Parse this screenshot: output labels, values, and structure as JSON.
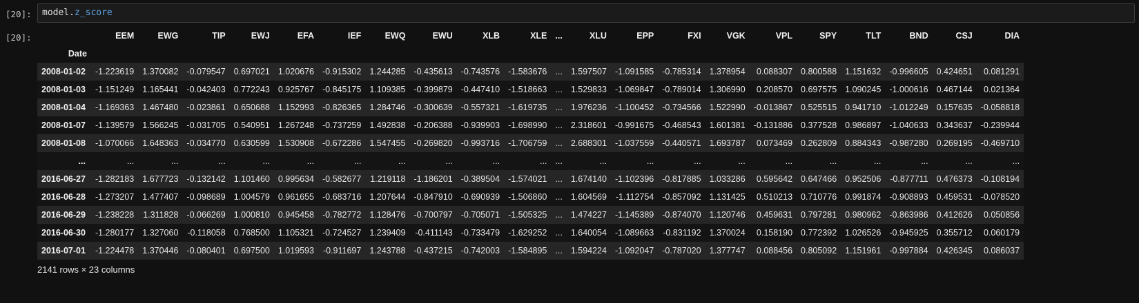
{
  "cell": {
    "in_prompt": "[20]:",
    "out_prompt": "[20]:",
    "code_object": "model.",
    "code_attr": "z_score"
  },
  "table": {
    "index_name": "Date",
    "columns": [
      "EEM",
      "EWG",
      "TIP",
      "EWJ",
      "EFA",
      "IEF",
      "EWQ",
      "EWU",
      "XLB",
      "XLE",
      "...",
      "XLU",
      "EPP",
      "FXI",
      "VGK",
      "VPL",
      "SPY",
      "TLT",
      "BND",
      "CSJ",
      "DIA"
    ],
    "rows": [
      {
        "index": "2008-01-02",
        "values": [
          "-1.223619",
          "1.370082",
          "-0.079547",
          "0.697021",
          "1.020676",
          "-0.915302",
          "1.244285",
          "-0.435613",
          "-0.743576",
          "-1.583676",
          "...",
          "1.597507",
          "-1.091585",
          "-0.785314",
          "1.378954",
          "0.088307",
          "0.800588",
          "1.151632",
          "-0.996605",
          "0.424651",
          "0.081291"
        ]
      },
      {
        "index": "2008-01-03",
        "values": [
          "-1.151249",
          "1.165441",
          "-0.042403",
          "0.772243",
          "0.925767",
          "-0.845175",
          "1.109385",
          "-0.399879",
          "-0.447410",
          "-1.518663",
          "...",
          "1.529833",
          "-1.069847",
          "-0.789014",
          "1.306990",
          "0.208570",
          "0.697575",
          "1.090245",
          "-1.000616",
          "0.467144",
          "0.021364"
        ]
      },
      {
        "index": "2008-01-04",
        "values": [
          "-1.169363",
          "1.467480",
          "-0.023861",
          "0.650688",
          "1.152993",
          "-0.826365",
          "1.284746",
          "-0.300639",
          "-0.557321",
          "-1.619735",
          "...",
          "1.976236",
          "-1.100452",
          "-0.734566",
          "1.522990",
          "-0.013867",
          "0.525515",
          "0.941710",
          "-1.012249",
          "0.157635",
          "-0.058818"
        ]
      },
      {
        "index": "2008-01-07",
        "values": [
          "-1.139579",
          "1.566245",
          "-0.031705",
          "0.540951",
          "1.267248",
          "-0.737259",
          "1.492838",
          "-0.206388",
          "-0.939903",
          "-1.698990",
          "...",
          "2.318601",
          "-0.991675",
          "-0.468543",
          "1.601381",
          "-0.131886",
          "0.377528",
          "0.986897",
          "-1.040633",
          "0.343637",
          "-0.239944"
        ]
      },
      {
        "index": "2008-01-08",
        "values": [
          "-1.070066",
          "1.648363",
          "-0.034770",
          "0.630599",
          "1.530908",
          "-0.672286",
          "1.547455",
          "-0.269820",
          "-0.993716",
          "-1.706759",
          "...",
          "2.688301",
          "-1.037559",
          "-0.440571",
          "1.693787",
          "0.073469",
          "0.262809",
          "0.884343",
          "-0.987280",
          "0.269195",
          "-0.469710"
        ]
      },
      {
        "index": "...",
        "values": [
          "...",
          "...",
          "...",
          "...",
          "...",
          "...",
          "...",
          "...",
          "...",
          "...",
          "...",
          "...",
          "...",
          "...",
          "...",
          "...",
          "...",
          "...",
          "...",
          "...",
          "..."
        ]
      },
      {
        "index": "2016-06-27",
        "values": [
          "-1.282183",
          "1.677723",
          "-0.132142",
          "1.101460",
          "0.995634",
          "-0.582677",
          "1.219118",
          "-1.186201",
          "-0.389504",
          "-1.574021",
          "...",
          "1.674140",
          "-1.102396",
          "-0.817885",
          "1.033286",
          "0.595642",
          "0.647466",
          "0.952506",
          "-0.877711",
          "0.476373",
          "-0.108194"
        ]
      },
      {
        "index": "2016-06-28",
        "values": [
          "-1.273207",
          "1.477407",
          "-0.098689",
          "1.004579",
          "0.961655",
          "-0.683716",
          "1.207644",
          "-0.847910",
          "-0.690939",
          "-1.506860",
          "...",
          "1.604569",
          "-1.112754",
          "-0.857092",
          "1.131425",
          "0.510213",
          "0.710776",
          "0.991874",
          "-0.908893",
          "0.459531",
          "-0.078520"
        ]
      },
      {
        "index": "2016-06-29",
        "values": [
          "-1.238228",
          "1.311828",
          "-0.066269",
          "1.000810",
          "0.945458",
          "-0.782772",
          "1.128476",
          "-0.700797",
          "-0.705071",
          "-1.505325",
          "...",
          "1.474227",
          "-1.145389",
          "-0.874070",
          "1.120746",
          "0.459631",
          "0.797281",
          "0.980962",
          "-0.863986",
          "0.412626",
          "0.050856"
        ]
      },
      {
        "index": "2016-06-30",
        "values": [
          "-1.280177",
          "1.327060",
          "-0.118058",
          "0.768500",
          "1.105321",
          "-0.724527",
          "1.239409",
          "-0.411143",
          "-0.733479",
          "-1.629252",
          "...",
          "1.640054",
          "-1.089663",
          "-0.831192",
          "1.370024",
          "0.158190",
          "0.772392",
          "1.026526",
          "-0.945925",
          "0.355712",
          "0.060179"
        ]
      },
      {
        "index": "2016-07-01",
        "values": [
          "-1.224478",
          "1.370446",
          "-0.080401",
          "0.697500",
          "1.019593",
          "-0.911697",
          "1.243788",
          "-0.437215",
          "-0.742003",
          "-1.584895",
          "...",
          "1.594224",
          "-1.092047",
          "-0.787020",
          "1.377747",
          "0.088456",
          "0.805092",
          "1.151961",
          "-0.997884",
          "0.426345",
          "0.086037"
        ]
      }
    ]
  },
  "footer": {
    "shape_text": "2141 rows × 23 columns"
  }
}
